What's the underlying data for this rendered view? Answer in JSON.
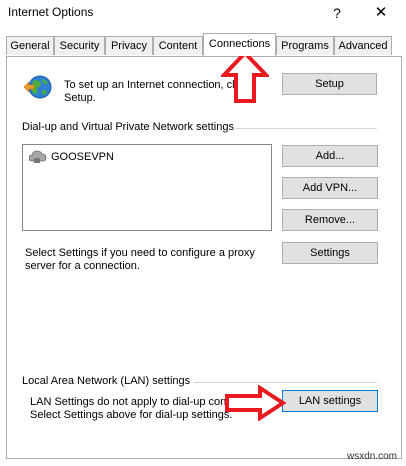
{
  "window": {
    "title": "Internet Options",
    "help_glyph": "?",
    "close_glyph": "✕"
  },
  "tabs": [
    {
      "label": "General"
    },
    {
      "label": "Security"
    },
    {
      "label": "Privacy"
    },
    {
      "label": "Content"
    },
    {
      "label": "Connections",
      "active": true
    },
    {
      "label": "Programs"
    },
    {
      "label": "Advanced"
    }
  ],
  "setup": {
    "text_line1": "To set up an Internet connection, click",
    "text_line2": "Setup.",
    "button": "Setup"
  },
  "vpn": {
    "section_label": "Dial-up and Virtual Private Network settings",
    "items": [
      "GOOSEVPN"
    ],
    "add_button": "Add...",
    "add_vpn_button": "Add VPN...",
    "remove_button": "Remove...",
    "settings_button": "Settings",
    "proxy_text_line1": "Select Settings if you need to configure a proxy",
    "proxy_text_line2": "server for a connection."
  },
  "lan": {
    "section_label": "Local Area Network (LAN) settings",
    "text_line1": "LAN Settings do not apply to dial-up connections.",
    "text_line2": "Select Settings above for dial-up settings.",
    "button": "LAN settings"
  },
  "footer": {
    "watermark": "wsxdn.com"
  },
  "colors": {
    "arrow": "#e8191f",
    "focus_border": "#0078d7",
    "button_bg": "#e1e1e1"
  }
}
